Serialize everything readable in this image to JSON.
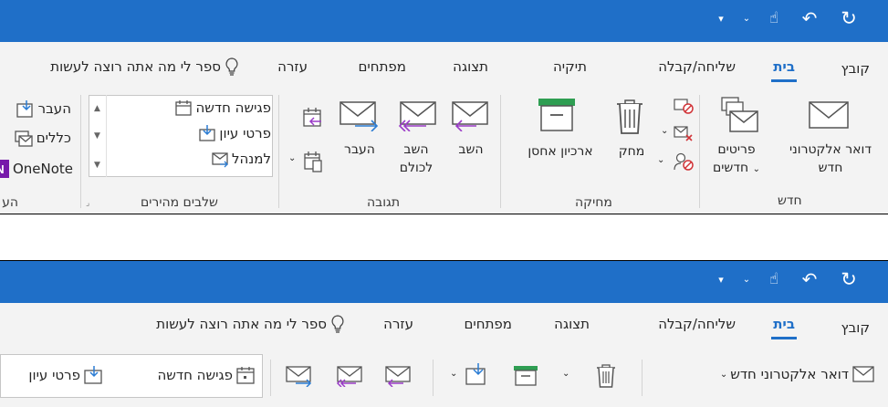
{
  "quick_access": {
    "customize": "▾",
    "touch": "☝",
    "undo": "↶",
    "sync": "↻"
  },
  "tabs": {
    "file": "קובץ",
    "home": "בית",
    "send_receive": "שליחה/קבלה",
    "folder": "תיקיה",
    "view": "תצוגה",
    "developer": "מפתחים",
    "help": "עזרה",
    "tell_me": "ספר לי מה אתה רוצה לעשות"
  },
  "ribbon_top": {
    "new_email": [
      "דואר אלקטרוני",
      "חדש"
    ],
    "new_items": [
      "פריטים",
      "חדשים"
    ],
    "new_group": "חדש",
    "archive": "ארכיון",
    "delete": "מחק",
    "store": "אחסן",
    "delete_group": "מחיקה",
    "reply": "השב",
    "reply_all": [
      "השב",
      "לכולם"
    ],
    "forward": "העבר",
    "respond_group": "תגובה",
    "quick_steps": [
      "פגישה חדשה",
      "פרטי עיון",
      "למנהל"
    ],
    "quick_steps_group": "שלבים מהירים",
    "move": "העבר",
    "rules": "כללים",
    "onenote": "OneNote",
    "move_group": "הע"
  },
  "ribbon_bottom": {
    "new_email": "דואר אלקטרוני חדש",
    "quick_steps": [
      "פגישה חדשה",
      "פרטי עיון"
    ]
  },
  "colors": {
    "accent": "#1f6fc8",
    "ribbon": "#f3f3f3",
    "reply": "#9b3cc8",
    "forward": "#2b7cd3",
    "delete_red": "#d13438"
  }
}
